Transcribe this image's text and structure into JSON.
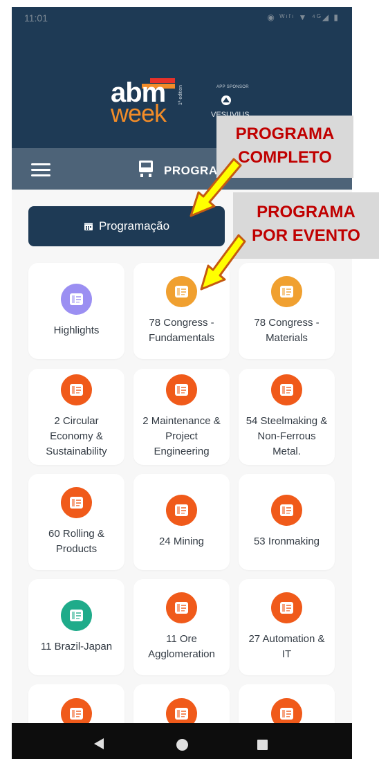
{
  "status_bar": {
    "time": "11:01",
    "icons": "◉ ᵂᶦᶠᶦ ▼ ⁴ᴳ◢ ▮"
  },
  "header": {
    "logo_line1": "abm",
    "logo_line2": "week",
    "logo_edition": "1ª edition",
    "sponsor_label": "APP SPONSOR",
    "sponsor_name": "VESUVIUS",
    "colors": {
      "navy": "#1e3a55",
      "orange": "#f28c28",
      "red": "#e8322a"
    }
  },
  "app_bar": {
    "title": "PROGRA",
    "menu_icon": "hamburger-menu-icon",
    "title_icon": "train-icon"
  },
  "program_button": {
    "label": "Programação",
    "icon": "calendar-icon"
  },
  "cards": [
    {
      "label": "Highlights",
      "color": "#9b8ff2"
    },
    {
      "label": "78 Congress - Fundamentals",
      "color": "#f0a030"
    },
    {
      "label": "78 Congress - Materials",
      "color": "#f0a030"
    },
    {
      "label": "2 Circular Economy & Sustainability",
      "color": "#f05a1a"
    },
    {
      "label": "2 Maintenance & Project Engineering",
      "color": "#f05a1a"
    },
    {
      "label": "54 Steelmaking & Non-Ferrous Metal.",
      "color": "#f05a1a"
    },
    {
      "label": "60 Rolling & Products",
      "color": "#f05a1a"
    },
    {
      "label": "24 Mining",
      "color": "#f05a1a"
    },
    {
      "label": "53 Ironmaking",
      "color": "#f05a1a"
    },
    {
      "label": "11 Brazil-Japan",
      "color": "#1fab8a"
    },
    {
      "label": "11 Ore Agglomeration",
      "color": "#f05a1a"
    },
    {
      "label": "27 Automation & IT",
      "color": "#f05a1a"
    },
    {
      "label": "",
      "color": "#f05a1a"
    },
    {
      "label": "",
      "color": "#f05a1a"
    },
    {
      "label": "",
      "color": "#f05a1a"
    }
  ],
  "annotations": {
    "full_program": [
      "PROGRAMA",
      "COMPLETO"
    ],
    "by_event": [
      "PROGRAMA",
      "POR EVENTO"
    ]
  },
  "nav_bar": {
    "back_icon": "back-triangle-icon",
    "home_icon": "home-circle-icon",
    "recent_icon": "recents-square-icon"
  }
}
